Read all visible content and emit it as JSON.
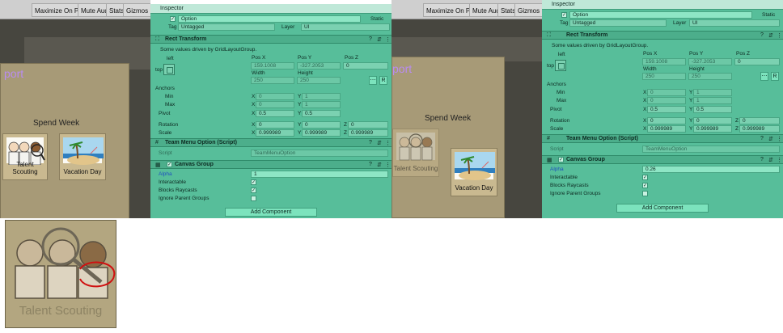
{
  "game_left": {
    "toolbar": [
      "Maximize On Play",
      "Mute Audio",
      "Stats",
      "Gizmos"
    ],
    "title_partial": "port",
    "heading": "Spend Week",
    "cards": [
      "Talent Scouting",
      "Vacation Day"
    ]
  },
  "game_right": {
    "toolbar": [
      "Maximize On Play",
      "Mute Audio",
      "Stats",
      "Gizmos"
    ],
    "title_partial": "port",
    "heading": "Spend Week",
    "cards": [
      "Talent Scouting",
      "Vacation Day"
    ]
  },
  "zoom_card": {
    "label": "Talent Scouting"
  },
  "inspector_left": {
    "tab": "Inspector",
    "object_name": "Option",
    "static_label": "Static",
    "tag_label": "Tag",
    "tag_value": "Untagged",
    "layer_label": "Layer",
    "layer_value": "UI",
    "rect_transform": {
      "title": "Rect Transform",
      "note": "Some values driven by GridLayoutGroup.",
      "anchor_preset_top": "left",
      "anchor_preset_side": "top",
      "pos_x_label": "Pos X",
      "pos_x": "159.1008",
      "pos_y_label": "Pos Y",
      "pos_y": "-327.2053",
      "pos_z_label": "Pos Z",
      "pos_z": "0",
      "width_label": "Width",
      "width": "250",
      "height_label": "Height",
      "height": "250",
      "r_button": "R",
      "anchors": "Anchors",
      "min": "Min",
      "min_x": "0",
      "min_y": "1",
      "max": "Max",
      "max_x": "0",
      "max_y": "1",
      "pivot": "Pivot",
      "pivot_x": "0.5",
      "pivot_y": "0.5",
      "rotation": "Rotation",
      "rot_x": "0",
      "rot_y": "0",
      "rot_z": "0",
      "scale": "Scale",
      "scale_x": "0.999989",
      "scale_y": "0.999989",
      "scale_z": "0.999989",
      "x": "X",
      "y": "Y",
      "z": "Z"
    },
    "script_component": {
      "title": "Team Menu Option (Script)",
      "script_label": "Script",
      "script_value": "TeamMenuOption"
    },
    "canvas_group": {
      "title": "Canvas Group",
      "alpha_label": "Alpha",
      "alpha": "1",
      "interactable": "Interactable",
      "blocks_raycasts": "Blocks Raycasts",
      "ignore_parent": "Ignore Parent Groups"
    },
    "add_component": "Add Component"
  },
  "inspector_right": {
    "tab": "Inspector",
    "object_name": "Option",
    "static_label": "Static",
    "tag_label": "Tag",
    "tag_value": "Untagged",
    "layer_label": "Layer",
    "layer_value": "UI",
    "rect_transform": {
      "title": "Rect Transform",
      "note": "Some values driven by GridLayoutGroup.",
      "anchor_preset_top": "left",
      "anchor_preset_side": "top",
      "pos_x_label": "Pos X",
      "pos_x": "159.1008",
      "pos_y_label": "Pos Y",
      "pos_y": "-327.2053",
      "pos_z_label": "Pos Z",
      "pos_z": "0",
      "width_label": "Width",
      "width": "250",
      "height_label": "Height",
      "height": "250",
      "r_button": "R",
      "anchors": "Anchors",
      "min": "Min",
      "min_x": "0",
      "min_y": "1",
      "max": "Max",
      "max_x": "0",
      "max_y": "1",
      "pivot": "Pivot",
      "pivot_x": "0.5",
      "pivot_y": "0.5",
      "rotation": "Rotation",
      "rot_x": "0",
      "rot_y": "0",
      "rot_z": "0",
      "scale": "Scale",
      "scale_x": "0.999989",
      "scale_y": "0.999989",
      "scale_z": "0.999989",
      "x": "X",
      "y": "Y",
      "z": "Z"
    },
    "script_component": {
      "title": "Team Menu Option (Script)",
      "script_label": "Script",
      "script_value": "TeamMenuOption"
    },
    "canvas_group": {
      "title": "Canvas Group",
      "alpha_label": "Alpha",
      "alpha": "0.26",
      "interactable": "Interactable",
      "blocks_raycasts": "Blocks Raycasts",
      "ignore_parent": "Ignore Parent Groups"
    },
    "add_component": "Add Component"
  }
}
